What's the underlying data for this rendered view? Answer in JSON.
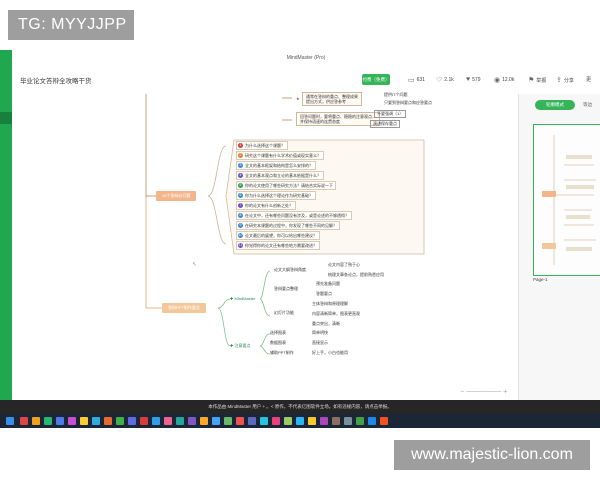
{
  "overlay": {
    "tag": "TG: MYYJJPP",
    "url": "www.majestic-lion.com"
  },
  "window": {
    "title": "MindMaster (Pro)"
  },
  "toolbar": {
    "doc_title": "毕业论文答辩全攻略干货",
    "badge": "付费（免费）",
    "stats": [
      {
        "icon": "page-icon",
        "value": "631"
      },
      {
        "icon": "heart-icon",
        "value": "2.1k"
      },
      {
        "icon": "like-icon",
        "value": "579"
      },
      {
        "icon": "eye-icon",
        "value": "12.0k"
      },
      {
        "icon": "bookmark-icon",
        "value": "举报"
      },
      {
        "icon": "share-icon",
        "value": "分享"
      }
    ],
    "more_label": "更"
  },
  "right_panel": {
    "primary_button": "轮廓模式",
    "secondary_tab": "等边",
    "page_label": "Page-1"
  },
  "mindmap": {
    "top_notes": [
      "通常问答较多不能自主提问，",
      "选择正确的答辩方式，明确观点"
    ],
    "top_right_box": {
      "line1": "通常在答辩的重点、整理成果",
      "line2": "提出方式，供应答参考"
    },
    "top_right_text": [
      "提供IT个问题",
      "只要到答辩要点和应答要点"
    ],
    "star_note": "准备好以下事项",
    "right_box2": {
      "line1": "回答问题时，要将重点、稳稳的注意观点，",
      "line2": "并保持语速的连贯态度"
    },
    "right_tags": [
      "不要强调（1）",
      "演讲保存重点"
    ],
    "branch1_label": "10个答辩必问题",
    "questions": [
      {
        "n": "1",
        "color": "#d33f3f",
        "text": "为什么选择这个课题？"
      },
      {
        "n": "2",
        "color": "#e67c2e",
        "text": "研究这个课题有什么学术价值或现实意义？"
      },
      {
        "n": "3",
        "color": "#3b86d6",
        "text": "全文的基本框架和结构是怎么安排的？"
      },
      {
        "n": "4",
        "color": "#6a4fc7",
        "text": "全文的基本观点和立论的基本依据是什么？"
      },
      {
        "n": "5",
        "color": "#2b9f5a",
        "text": "你的论文使用了哪些研究方法？请结合实际说一下"
      },
      {
        "n": "6",
        "color": "#2d8fd1",
        "text": "你为什么选择这个理论作为研究基础？"
      },
      {
        "n": "7",
        "color": "#6a4fc7",
        "text": "你的论文有什么创新之处？"
      },
      {
        "n": "8",
        "color": "#3b86d6",
        "text": "在论文中，还有哪些问题没有涉及，或是论述的不够透彻？"
      },
      {
        "n": "9",
        "color": "#3b86d6",
        "text": "在研究本课题的过程中，你发现了哪些不同的见解？"
      },
      {
        "n": "10",
        "color": "#3b86d6",
        "text": "论文最后的展望，你可以给出哪些建议？"
      },
      {
        "n": "11",
        "color": "#6a4fc7",
        "text": "你觉得你的论文还有哪些地方需要改进？"
      }
    ],
    "branch2_label": "答辩PPT制作要点",
    "subnodes": [
      {
        "label": "MindMaster"
      },
      {
        "label": "注意要点"
      }
    ],
    "ppt_items": [
      "论文大纲答辩角度",
      "论文内容了熟于心",
      "梳理文章各论点，提前熟悉应用",
      "答辩要点整理",
      "预先准备问题",
      "答题要点",
      "幻灯片功能",
      "主体答辩和原理理解",
      "内容清晰简单，图表更直观",
      "重点突出，清晰",
      "逐页表",
      "注意要点",
      "选择图表",
      "简单明快",
      "数据图表",
      "直接显示",
      "辅助PPT制作",
      "好上手，小白也能用"
    ]
  },
  "statusbar": {
    "text": "本作品由 MindMaster 用户 + 。< 原作，不代表亿图软件立场。如有违规内容，请点击举报。"
  }
}
